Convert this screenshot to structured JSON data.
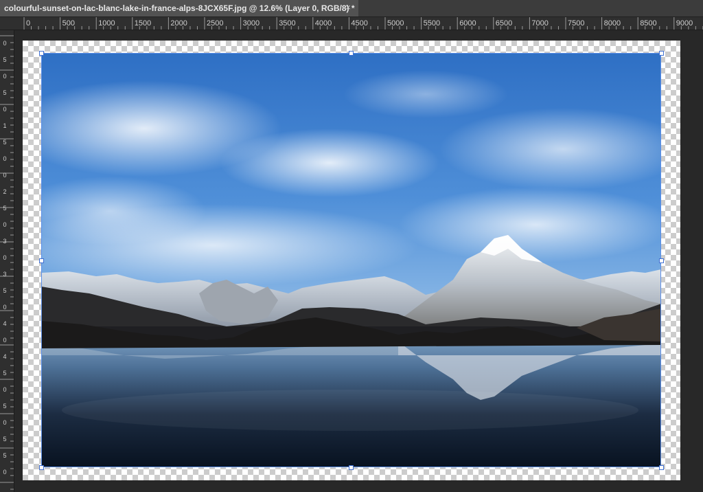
{
  "document": {
    "tab_title": "colourful-sunset-on-lac-blanc-lake-in-france-alps-8JCX65F.jpg @ 12.6% (Layer 0, RGB/8) *",
    "close_glyph": "×"
  },
  "ruler": {
    "horizontal_labels": [
      "0",
      "500",
      "1000",
      "1500",
      "2000",
      "2500",
      "3000",
      "3500",
      "4000",
      "4500",
      "5000",
      "5500",
      "6000",
      "6500",
      "7000",
      "7500",
      "8000",
      "8500",
      "9000"
    ],
    "vertical_labels": [
      "0",
      "5",
      "0",
      "5",
      "0",
      "1",
      "5",
      "0",
      "0",
      "2",
      "5",
      "0",
      "3",
      "0",
      "3",
      "5",
      "0",
      "4",
      "0",
      "4",
      "5",
      "0",
      "5",
      "0",
      "5",
      "5",
      "0"
    ]
  },
  "image": {
    "description_icon": "landscape-image",
    "zoom_percent": 12.6,
    "layer": "Layer 0",
    "mode": "RGB/8"
  },
  "colors": {
    "app_background": "#282828",
    "tab_active": "#525252",
    "selection_border": "#5a8ee8"
  }
}
